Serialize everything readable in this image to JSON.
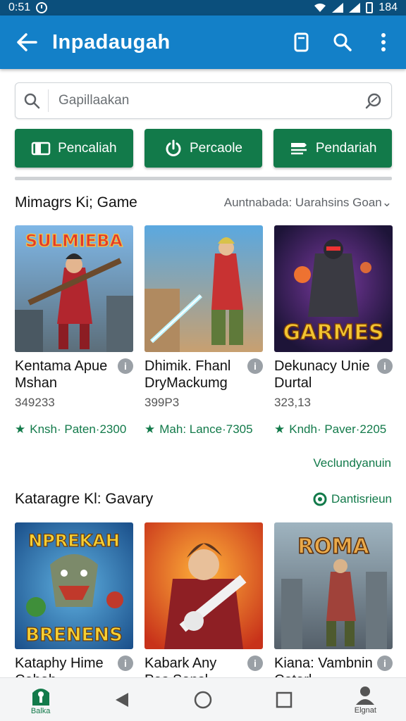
{
  "status": {
    "time": "0:51",
    "battery": "184"
  },
  "appbar": {
    "title": "Inpadaugah"
  },
  "search": {
    "placeholder": "Gapillaakan"
  },
  "pills": [
    {
      "label": "Pencaliah",
      "icon": "tablet-icon"
    },
    {
      "label": "Percaole",
      "icon": "power-icon"
    },
    {
      "label": "Pendariah",
      "icon": "menu-list-icon"
    }
  ],
  "progress": 1.0,
  "section1": {
    "title": "Mimagrs Ki; Game",
    "link": "Auntnabada: Uarahsins Goan",
    "cards": [
      {
        "title": "Kentama Apue Mshan",
        "count": "349233",
        "meta": "Knsh· Paten·2300",
        "art_text": "SULMIEBA"
      },
      {
        "title": "Dhimik. Fhanl DryMackumg",
        "count": "399P3",
        "meta": "Mah: Lance·7305",
        "art_text": ""
      },
      {
        "title": "Dekunacy Unie Durtal",
        "count": "323,13",
        "meta": "Kndh· Paver·2205",
        "art_text": "GARMES"
      }
    ]
  },
  "see_more": "Veclundyanuin",
  "section2": {
    "title": "Kataragre Kl: Gavary",
    "link": "Dantisrieun",
    "cards": [
      {
        "title": "Kataphy Hime Cahah",
        "art_text_top": "NPREKAH",
        "art_text_bottom": "BRENENS"
      },
      {
        "title": "Kabark Any Pas Sansl",
        "art_text_top": "",
        "art_text_bottom": ""
      },
      {
        "title": "Kiana: Vambnin Catarl",
        "art_text_top": "ROMA",
        "art_text_bottom": ""
      }
    ]
  },
  "nav": {
    "left_label": "Balka",
    "right_label": "Elgnat"
  },
  "colors": {
    "appbar": "#1380c8",
    "statusbar": "#0b4f7c",
    "accent": "#127a4a"
  }
}
